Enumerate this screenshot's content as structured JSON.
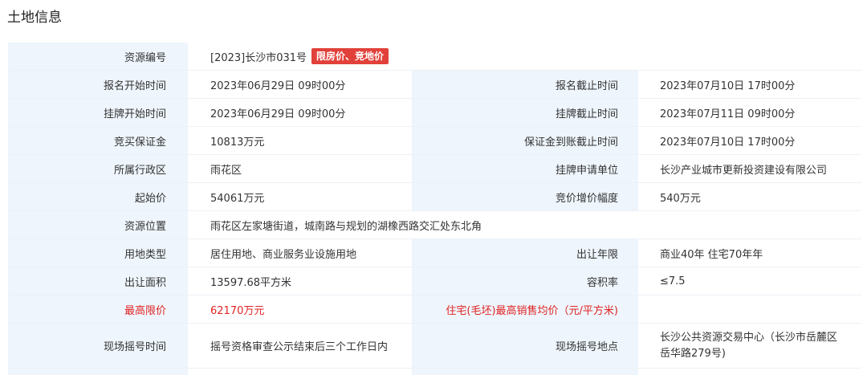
{
  "section_title": "土地信息",
  "rows": [
    {
      "label": "资源编号",
      "value": "[2023]长沙市031号",
      "badge": "限房价、竞地价"
    },
    {
      "label": "报名开始时间",
      "value": "2023年06月29日 09时00分",
      "label2": "报名截止时间",
      "value2": "2023年07月10日 17时00分"
    },
    {
      "label": "挂牌开始时间",
      "value": "2023年06月29日 09时00分",
      "label2": "挂牌截止时间",
      "value2": "2023年07月11日 09时00分"
    },
    {
      "label": "竞买保证金",
      "value": "10813万元",
      "label2": "保证金到账截止时间",
      "value2": "2023年07月10日 17时00分"
    },
    {
      "label": "所属行政区",
      "value": "雨花区",
      "label2": "挂牌申请单位",
      "value2": "长沙产业城市更新投资建设有限公司"
    },
    {
      "label": "起始价",
      "value": "54061万元",
      "label2": "竞价增价幅度",
      "value2": "540万元"
    },
    {
      "label": "资源位置",
      "value": "雨花区左家塘街道，城南路与规划的湖橡西路交汇处东北角"
    },
    {
      "label": "用地类型",
      "value": "居住用地、商业服务业设施用地",
      "label2": "出让年限",
      "value2": "商业40年 住宅70年年"
    },
    {
      "label": "出让面积",
      "value": "13597.68平方米",
      "label2": "容积率",
      "value2": "≤7.5"
    },
    {
      "label": "最高限价",
      "value": "62170万元",
      "label2": "住宅(毛坯)最高销售均价（元/平方米)",
      "value2": ""
    },
    {
      "label": "现场摇号时间",
      "value": "摇号资格审查公示结束后三个工作日内",
      "label2": "现场摇号地点",
      "value2_line1": "长沙公共资源交易中心（长沙市岳麓区",
      "value2_line2": "岳华路279号)"
    }
  ],
  "colors": {
    "label_bg": "#eef5fc",
    "highlight_red": "#e02424",
    "badge_bg": "#e1413a"
  }
}
